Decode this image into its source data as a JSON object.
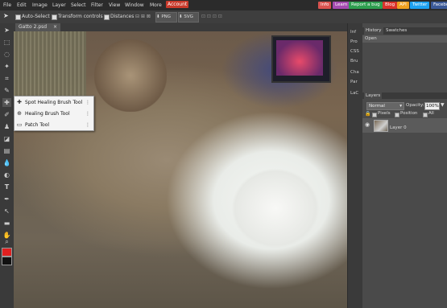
{
  "menubar": {
    "items": [
      "File",
      "Edit",
      "Image",
      "Layer",
      "Select",
      "Filter",
      "View",
      "Window",
      "More"
    ],
    "account": "Account",
    "buttons": [
      {
        "label": "Info",
        "color": "#d9534f"
      },
      {
        "label": "Learn",
        "color": "#a44bb0"
      },
      {
        "label": "Report a bug",
        "color": "#2e9e4f"
      },
      {
        "label": "Blog",
        "color": "#d9322b"
      },
      {
        "label": "API",
        "color": "#f0a020"
      },
      {
        "label": "Twitter",
        "color": "#1da1f2"
      },
      {
        "label": "Facebook",
        "color": "#3b5998"
      }
    ]
  },
  "options": {
    "auto_select": "Auto-Select",
    "transform_controls": "Transform controls",
    "distances": "Distances",
    "export_png": "PNG",
    "export_svg": "SVG",
    "zoom_label": "⊡⊡"
  },
  "document": {
    "tab_label": "Gatto 2.psd",
    "close_icon": "×"
  },
  "context_menu": {
    "items": [
      {
        "label": "Spot Healing Brush Tool",
        "icon": "spot-healing-brush-icon",
        "glyph": "✚"
      },
      {
        "label": "Healing Brush Tool",
        "icon": "healing-brush-icon",
        "glyph": "⊕"
      },
      {
        "label": "Patch Tool",
        "icon": "patch-icon",
        "glyph": "▭"
      }
    ]
  },
  "panel_icons": [
    "Inf",
    "Pro",
    "CSS",
    "Bru",
    "Cha",
    "Par",
    "LaC"
  ],
  "history_panel": {
    "tabs": [
      "History",
      "Swatches"
    ],
    "items": [
      "Open"
    ]
  },
  "layers_panel": {
    "title": "Layers",
    "blend_mode": "Normal",
    "opacity_label": "Opacity:",
    "opacity_value": "100%",
    "lock_options": [
      "Pixels",
      "Position",
      "All"
    ],
    "layers": [
      {
        "name": "Layer 0",
        "visible": true
      }
    ]
  },
  "colors": {
    "foreground": "#e02020",
    "background": "#111111",
    "accent": "#c93a2b"
  }
}
